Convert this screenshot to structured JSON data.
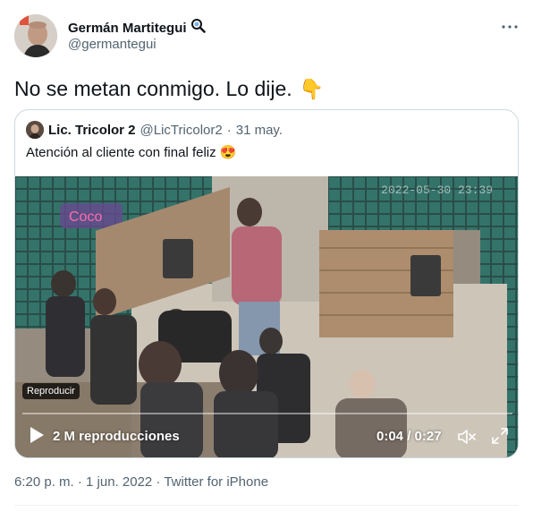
{
  "author": {
    "name": "Germán Martitegui",
    "handle": "@germantegui"
  },
  "tweet": {
    "text": "No se metan conmigo. Lo dije.",
    "emoji": "👇"
  },
  "quoted": {
    "name": "Lic. Tricolor 2",
    "handle": "@LicTricolor2",
    "separator": "·",
    "date": "31 may.",
    "text": "Atención al cliente con final feliz",
    "emoji": "😍"
  },
  "video": {
    "reproducir_label": "Reproducir",
    "views": "2 M reproducciones",
    "time": "0:04 / 0:27",
    "watermark": "2022-05-30 23:39",
    "progress": 0.0
  },
  "meta": {
    "timestamp": "6:20 p. m. · 1 jun. 2022 · Twitter for iPhone"
  },
  "icons": {
    "verified": "magnifier-badge-icon",
    "more": "more-icon",
    "play": "play-icon",
    "mute": "mute-icon",
    "fullscreen": "fullscreen-icon"
  },
  "colors": {
    "text": "#0f1419",
    "secondary": "#536471",
    "border": "#cfd9de"
  }
}
